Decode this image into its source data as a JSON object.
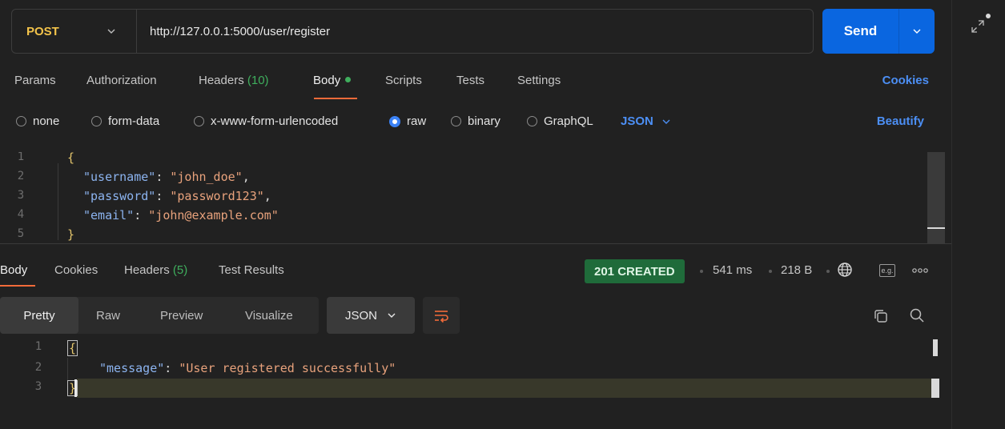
{
  "request": {
    "method": "POST",
    "url": "http://127.0.0.1:5000/user/register",
    "send_label": "Send"
  },
  "request_tabs": {
    "params": "Params",
    "authorization": "Authorization",
    "headers": "Headers",
    "headers_count": "(10)",
    "body": "Body",
    "scripts": "Scripts",
    "tests": "Tests",
    "settings": "Settings",
    "cookies": "Cookies"
  },
  "body_types": {
    "none": "none",
    "form_data": "form-data",
    "urlencoded": "x-www-form-urlencoded",
    "raw": "raw",
    "binary": "binary",
    "graphql": "GraphQL",
    "selected": "raw",
    "language": "JSON",
    "beautify": "Beautify"
  },
  "request_body": {
    "line_numbers": [
      "1",
      "2",
      "3",
      "4",
      "5"
    ],
    "open_brace": "{",
    "close_brace": "}",
    "lines": [
      {
        "key": "\"username\"",
        "value": "\"john_doe\"",
        "comma": ","
      },
      {
        "key": "\"password\"",
        "value": "\"password123\"",
        "comma": ","
      },
      {
        "key": "\"email\"",
        "value": "\"john@example.com\"",
        "comma": ""
      }
    ]
  },
  "response_tabs": {
    "body": "Body",
    "cookies": "Cookies",
    "headers": "Headers",
    "headers_count": "(5)",
    "test_results": "Test Results"
  },
  "response_meta": {
    "status": "201 CREATED",
    "time": "541 ms",
    "size": "218 B",
    "example_label": "e.g."
  },
  "response_toolbar": {
    "pretty": "Pretty",
    "raw": "Raw",
    "preview": "Preview",
    "visualize": "Visualize",
    "language": "JSON"
  },
  "response_body": {
    "line_numbers": [
      "1",
      "2",
      "3"
    ],
    "open_brace": "{",
    "close_brace": "}",
    "key": "\"message\"",
    "value": "\"User registered successfully\""
  },
  "colors": {
    "accent_blue": "#0a66e0",
    "method_color": "#f3c34a",
    "status_green": "#1f6b3a",
    "tab_underline": "#f26b3a"
  }
}
